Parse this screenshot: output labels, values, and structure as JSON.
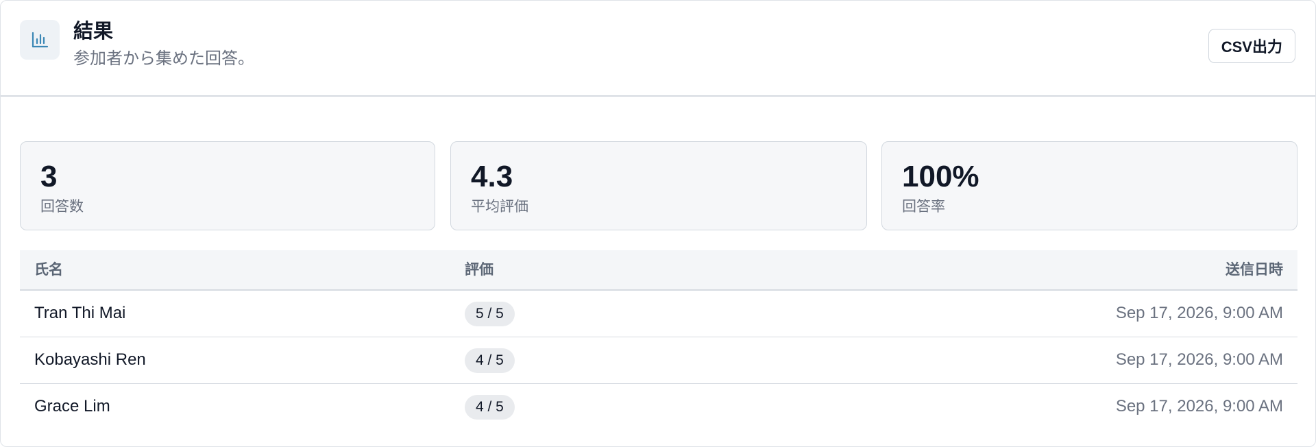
{
  "header": {
    "title": "結果",
    "subtitle": "参加者から集めた回答。",
    "icon": "bar-chart-icon",
    "export_label": "CSV出力"
  },
  "stats": [
    {
      "value": "3",
      "label": "回答数"
    },
    {
      "value": "4.3",
      "label": "平均評価"
    },
    {
      "value": "100%",
      "label": "回答率"
    }
  ],
  "table": {
    "columns": [
      "氏名",
      "評価",
      "送信日時"
    ],
    "rows": [
      {
        "name": "Tran Thi Mai",
        "rating": "5 / 5",
        "submitted": "Sep 17, 2026, 9:00 AM"
      },
      {
        "name": "Kobayashi Ren",
        "rating": "4 / 5",
        "submitted": "Sep 17, 2026, 9:00 AM"
      },
      {
        "name": "Grace Lim",
        "rating": "4 / 5",
        "submitted": "Sep 17, 2026, 9:00 AM"
      }
    ]
  },
  "colors": {
    "icon_accent": "#3a87b5",
    "card_bg": "#f6f7f9",
    "border": "#d6dbe1",
    "text_primary": "#111827",
    "text_muted": "#6b7280"
  }
}
